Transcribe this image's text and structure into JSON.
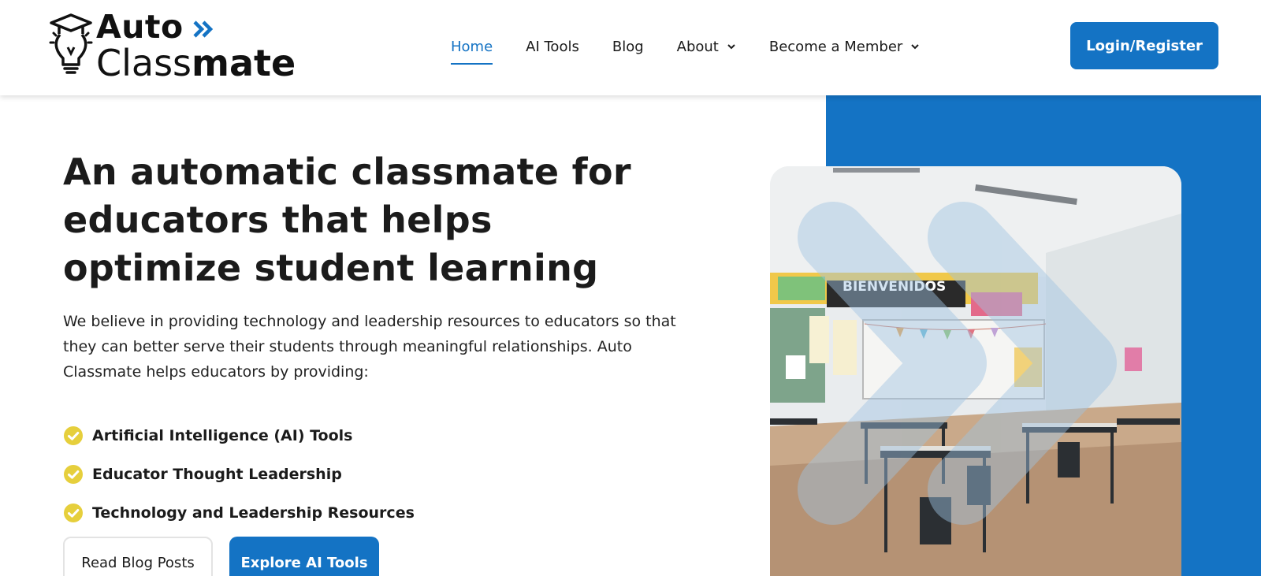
{
  "brand": {
    "line1": "Auto",
    "line2_light": "Class",
    "line2_bold": "mate",
    "accent_color": "#1473c4",
    "logo_icon": "graduation-cap-lightbulb-icon",
    "arrows_icon": "double-chevron-right-icon"
  },
  "nav": {
    "items": [
      {
        "label": "Home",
        "active": true
      },
      {
        "label": "AI Tools"
      },
      {
        "label": "Blog"
      },
      {
        "label": "About",
        "dropdown": true
      },
      {
        "label": "Become a Member",
        "dropdown": true
      }
    ],
    "login_label": "Login/Register"
  },
  "hero": {
    "headline": "An automatic classmate for educators that helps optimize student learning",
    "intro": "We believe in providing technology and leadership resources to educators so that they can better serve their students through meaningful relationships. Auto Classmate helps educators by providing:",
    "features": [
      "Artificial Intelligence (AI) Tools",
      "Educator Thought Leadership",
      "Technology and Leadership Resources"
    ],
    "check_icon": "check-circle-icon",
    "check_color": "#e6cf3c",
    "buttons": {
      "secondary": "Read Blog Posts",
      "primary": "Explore AI Tools"
    },
    "image": {
      "banner_text": "BIENVENIDOS"
    }
  },
  "colors": {
    "primary": "#1473c4",
    "text": "#1b1b1b",
    "background": "#ffffff"
  }
}
